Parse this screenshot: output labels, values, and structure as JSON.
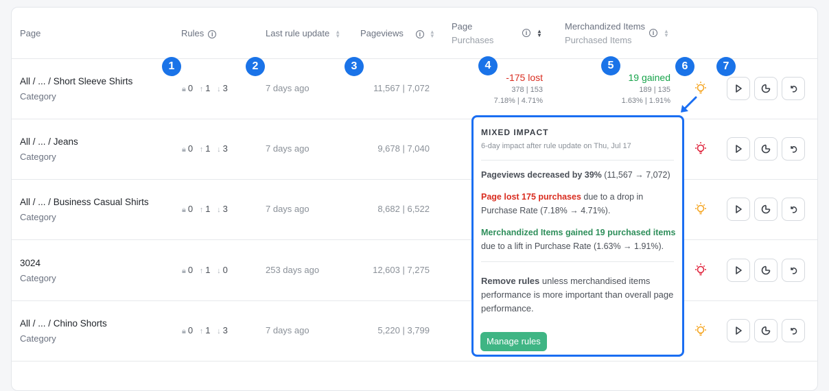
{
  "headers": {
    "page": "Page",
    "rules": "Rules",
    "last_update": "Last rule update",
    "pageviews": "Pageviews",
    "page_purchases": "Page",
    "page_purchases_sub": "Purchases",
    "merch_items": "Merchandized Items",
    "merch_items_sub": "Purchased Items"
  },
  "rows": [
    {
      "name": "All / ... / Short Sleeve Shirts",
      "type": "Category",
      "locked": "0",
      "up": "1",
      "down": "3",
      "updated": "7 days ago",
      "pageviews": "11,567 | 7,072",
      "page_delta": "-175 lost",
      "page_counts": "378 | 153",
      "page_rates": "7.18% | 4.71%",
      "merch_delta": "19 gained",
      "merch_counts": "189 | 135",
      "merch_rates": "1.63% | 1.91%",
      "bulb_color": "#f5a623"
    },
    {
      "name": "All / ... / Jeans",
      "type": "Category",
      "locked": "0",
      "up": "1",
      "down": "3",
      "updated": "7 days ago",
      "pageviews": "9,678 | 7,040",
      "bulb_color": "#e0243c"
    },
    {
      "name": "All / ... / Business Casual Shirts",
      "type": "Category",
      "locked": "0",
      "up": "1",
      "down": "3",
      "updated": "7 days ago",
      "pageviews": "8,682 | 6,522",
      "bulb_color": "#f5a623"
    },
    {
      "name": "3024",
      "type": "Category",
      "locked": "0",
      "up": "1",
      "down": "0",
      "updated": "253 days ago",
      "pageviews": "12,603 | 7,275",
      "bulb_color": "#e0243c"
    },
    {
      "name": "All / ... / Chino Shorts",
      "type": "Category",
      "locked": "0",
      "up": "1",
      "down": "3",
      "updated": "7 days ago",
      "pageviews": "5,220 | 3,799",
      "bulb_color": "#f5a623"
    }
  ],
  "badges": [
    "1",
    "2",
    "3",
    "4",
    "5",
    "6",
    "7"
  ],
  "popup": {
    "title": "MIXED IMPACT",
    "subtitle": "6-day impact after rule update on Thu, Jul 17",
    "pv_bold": "Pageviews decreased by 39%",
    "pv_rest": " (11,567 → 7,072)",
    "page_bold": "Page lost 175 purchases",
    "page_rest": " due to a drop in Purchase Rate (7.18% → 4.71%).",
    "merch_bold": "Merchandized Items gained 19 purchased items",
    "merch_rest": " due to a lift in Purchase Rate (1.63% → 1.91%).",
    "advice_bold": "Remove rules",
    "advice_rest": " unless merchandised items performance is more important than overall page performance.",
    "button": "Manage rules"
  },
  "colors": {
    "accent_blue": "#1a6ef2",
    "badge_blue": "#1a73e8",
    "lost_red": "#d92d20",
    "gain_green": "#16a34a",
    "button_green": "#3fb584"
  }
}
